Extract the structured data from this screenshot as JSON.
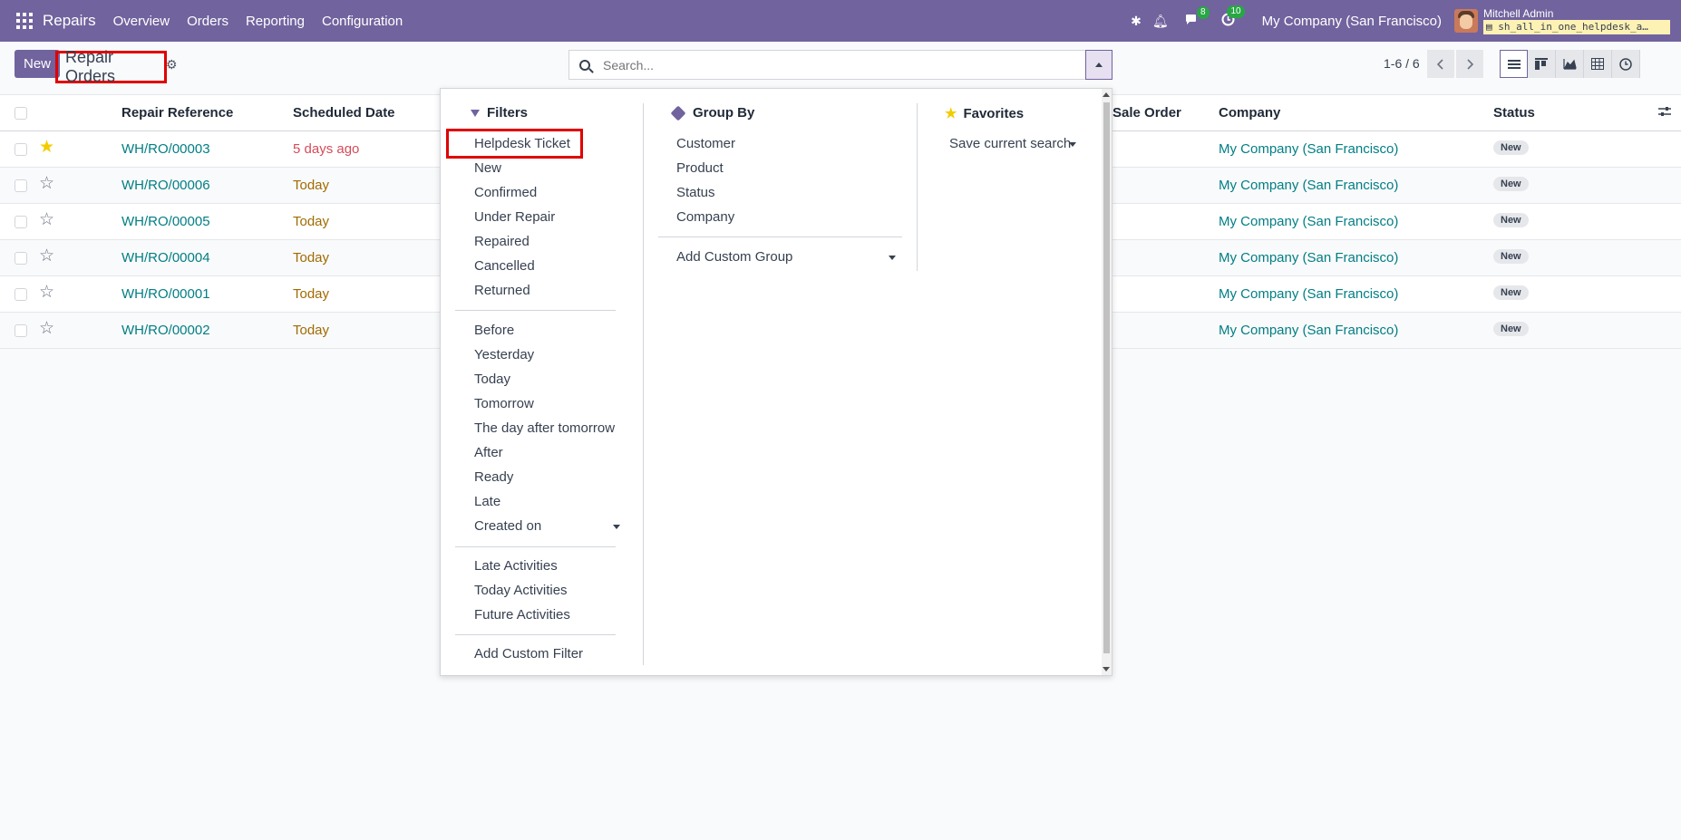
{
  "navbar": {
    "app_name": "Repairs",
    "menu": [
      "Overview",
      "Orders",
      "Reporting",
      "Configuration"
    ],
    "messages_count": "8",
    "activities_count": "10",
    "company": "My Company (San Francisco)",
    "user_name": "Mitchell Admin",
    "database": "sh_all_in_one_helpdesk_a…"
  },
  "control_panel": {
    "new_label": "New",
    "breadcrumb": "Repair Orders",
    "search_placeholder": "Search...",
    "pager": "1-6 / 6"
  },
  "table": {
    "headers": {
      "reference": "Repair Reference",
      "scheduled_date": "Scheduled Date",
      "sale_order": "Sale Order",
      "company": "Company",
      "status": "Status"
    },
    "rows": [
      {
        "favorite": true,
        "reference": "WH/RO/00003",
        "date": "5 days ago",
        "date_state": "overdue",
        "company": "My Company (San Francisco)",
        "status": "New"
      },
      {
        "favorite": false,
        "reference": "WH/RO/00006",
        "date": "Today",
        "date_state": "today",
        "company": "My Company (San Francisco)",
        "status": "New"
      },
      {
        "favorite": false,
        "reference": "WH/RO/00005",
        "date": "Today",
        "date_state": "today",
        "company": "My Company (San Francisco)",
        "status": "New"
      },
      {
        "favorite": false,
        "reference": "WH/RO/00004",
        "date": "Today",
        "date_state": "today",
        "company": "My Company (San Francisco)",
        "status": "New"
      },
      {
        "favorite": false,
        "reference": "WH/RO/00001",
        "date": "Today",
        "date_state": "today",
        "company": "My Company (San Francisco)",
        "status": "New"
      },
      {
        "favorite": false,
        "reference": "WH/RO/00002",
        "date": "Today",
        "date_state": "today",
        "company": "My Company (San Francisco)",
        "status": "New"
      }
    ]
  },
  "dropdown": {
    "filters_title": "Filters",
    "filters": {
      "helpdesk_ticket": "Helpdesk Ticket",
      "new": "New",
      "confirmed": "Confirmed",
      "under_repair": "Under Repair",
      "repaired": "Repaired",
      "cancelled": "Cancelled",
      "returned": "Returned",
      "before": "Before",
      "yesterday": "Yesterday",
      "today": "Today",
      "tomorrow": "Tomorrow",
      "day_after_tomorrow": "The day after tomorrow",
      "after": "After",
      "ready": "Ready",
      "late": "Late",
      "created_on": "Created on",
      "late_activities": "Late Activities",
      "today_activities": "Today Activities",
      "future_activities": "Future Activities",
      "add_custom_filter": "Add Custom Filter"
    },
    "group_by_title": "Group By",
    "group_by": [
      "Customer",
      "Product",
      "Status",
      "Company"
    ],
    "add_custom_group": "Add Custom Group",
    "favorites_title": "Favorites",
    "save_current_search": "Save current search"
  },
  "colors": {
    "brand": "#71639e",
    "link": "#017e84",
    "overdue": "#d44c59",
    "today": "#a06b00",
    "highlight": "#e00000"
  }
}
